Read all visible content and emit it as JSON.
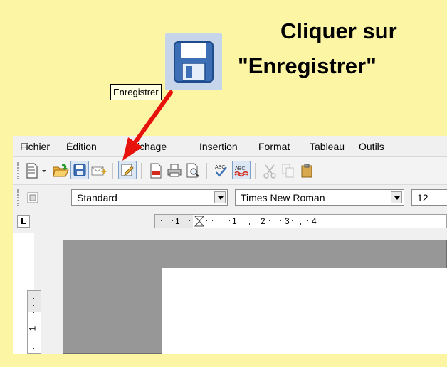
{
  "instruction": {
    "line1": "Cliquer sur",
    "line2": "\"Enregistrer\""
  },
  "icons": {
    "big_save": "floppy-disk-icon",
    "arrow": "red-arrow"
  },
  "colors": {
    "background_yellow": "#fcf5a4",
    "arrow_red": "#e8120c",
    "save_icon_blue": "#3b6fb6",
    "tooltip_bg": "#ffffe1"
  },
  "menubar": {
    "items": [
      {
        "label": "Fichier"
      },
      {
        "label": "Édition"
      },
      {
        "label": "Affichage"
      },
      {
        "label": "Insertion"
      },
      {
        "label": "Format"
      },
      {
        "label": "Tableau"
      },
      {
        "label": "Outils"
      }
    ]
  },
  "toolbar": {
    "buttons": [
      "new-document-icon",
      "open-folder-icon",
      "save-icon",
      "email-document-icon",
      "edit-mode-icon",
      "export-pdf-icon",
      "print-icon",
      "page-preview-icon",
      "spellcheck-icon",
      "auto-spellcheck-icon",
      "cut-icon",
      "copy-icon",
      "paste-icon"
    ]
  },
  "format_bar": {
    "style_value": "Standard",
    "font_value": "Times New Roman",
    "size_value": "12"
  },
  "tooltip": {
    "text": "Enregistrer"
  },
  "ruler": {
    "labels": [
      "1",
      "1",
      "2",
      "3",
      "4"
    ],
    "vertical_label": "1"
  }
}
